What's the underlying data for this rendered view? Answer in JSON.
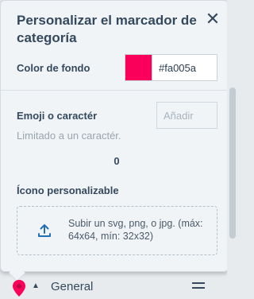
{
  "panel": {
    "title": "Personalizar el marcador de categoría",
    "close_label": "✕",
    "background_color_label": "Color de fondo",
    "background_color_value": "#fa005a",
    "emoji_label": "Emoji o caractér",
    "emoji_placeholder": "Añadir",
    "emoji_hint": "Limitado a un caractér.",
    "emoji_count": "0",
    "custom_icon_label": "Ícono personalizable",
    "upload_text": "Subir un svg, png, o jpg. (máx: 64x64, mín: 32x32)",
    "upload_icon": "upload-icon"
  },
  "category_row": {
    "name": "General",
    "marker_color": "#fa005a",
    "marker_icon": "map-pin-icon",
    "caret_icon": "caret-up-icon",
    "drag_icon": "drag-handle-icon"
  }
}
